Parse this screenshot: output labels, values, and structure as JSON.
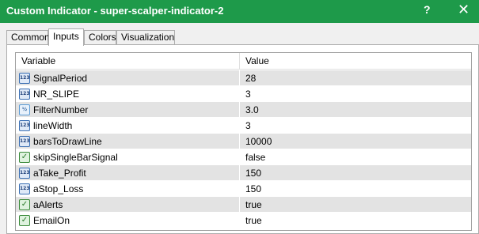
{
  "window": {
    "title": "Custom Indicator - super-scalper-indicator-2",
    "help_label": "?",
    "close_label": "✕"
  },
  "tabs": [
    {
      "label": "Common"
    },
    {
      "label": "Inputs"
    },
    {
      "label": "Colors"
    },
    {
      "label": "Visualization"
    }
  ],
  "grid": {
    "headers": {
      "variable": "Variable",
      "value": "Value"
    },
    "rows": [
      {
        "name": "SignalPeriod",
        "value": "28",
        "icon": "123"
      },
      {
        "name": "NR_SLIPE",
        "value": "3",
        "icon": "123"
      },
      {
        "name": "FilterNumber",
        "value": "3.0",
        "icon": "½"
      },
      {
        "name": "lineWidth",
        "value": "3",
        "icon": "123"
      },
      {
        "name": "barsToDrawLine",
        "value": "10000",
        "icon": "123"
      },
      {
        "name": "skipSingleBarSignal",
        "value": "false",
        "icon": "✓"
      },
      {
        "name": "aTake_Profit",
        "value": "150",
        "icon": "123"
      },
      {
        "name": "aStop_Loss",
        "value": "150",
        "icon": "123"
      },
      {
        "name": "aAlerts",
        "value": "true",
        "icon": "✓"
      },
      {
        "name": "EmailOn",
        "value": "true",
        "icon": "✓"
      }
    ]
  },
  "colors": {
    "titlebar": "#1e9a4a",
    "row_alt": "#e3e3e3"
  }
}
